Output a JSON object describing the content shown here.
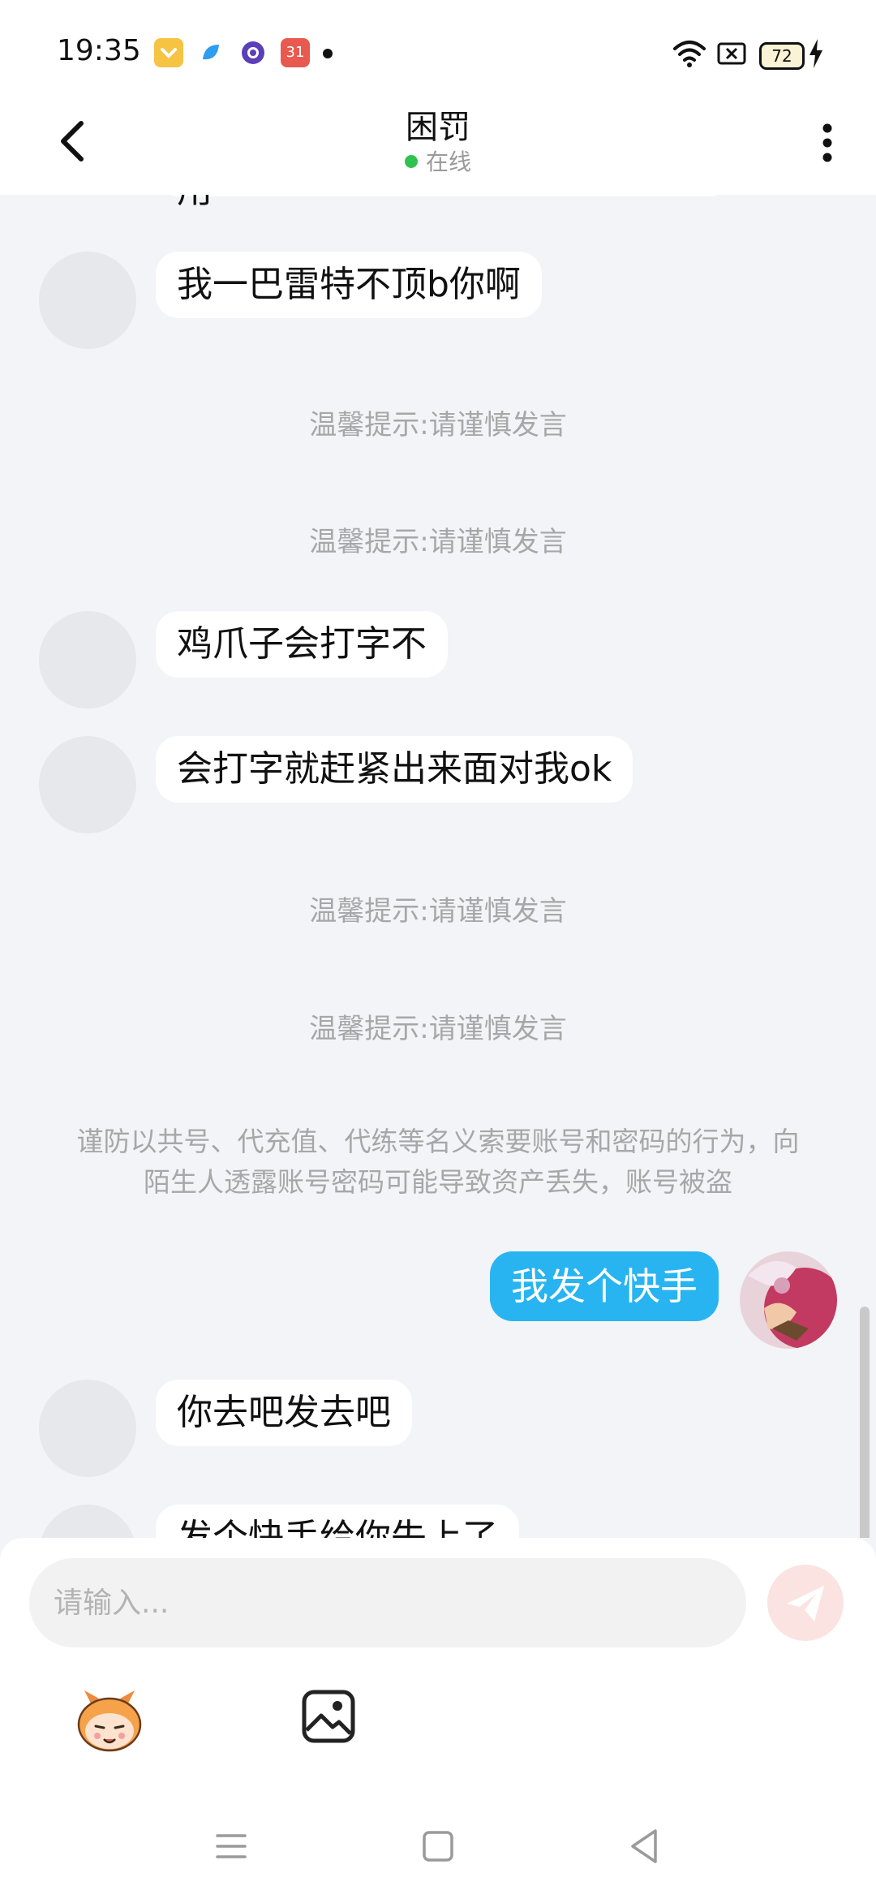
{
  "status_bar": {
    "time": "19:35",
    "app_icons": [
      {
        "name": "chevron-app-icon",
        "color": "#f6c343"
      },
      {
        "name": "blue-app-icon",
        "color": "#2f9cf0"
      },
      {
        "name": "purple-app-icon",
        "color": "#5b3fb8"
      },
      {
        "name": "calendar-app-icon",
        "color": "#e85a4f",
        "text": "31"
      }
    ],
    "battery": "72"
  },
  "header": {
    "title": "困罚",
    "status": "在线"
  },
  "chat": {
    "partial_top_text": "用",
    "messages": [
      {
        "type": "in",
        "text": "我一巴雷特不顶b你啊"
      },
      {
        "type": "notice",
        "text": "温馨提示:请谨慎发言"
      },
      {
        "type": "notice",
        "text": "温馨提示:请谨慎发言"
      },
      {
        "type": "in",
        "text": "鸡爪子会打字不"
      },
      {
        "type": "in",
        "text": "会打字就赶紧出来面对我ok"
      },
      {
        "type": "notice",
        "text": "温馨提示:请谨慎发言"
      },
      {
        "type": "notice",
        "text": "温馨提示:请谨慎发言"
      },
      {
        "type": "warning",
        "text": "谨防以共号、代充值、代练等名义索要账号和密码的行为，向陌生人透露账号密码可能导致资产丢失，账号被盗"
      },
      {
        "type": "out",
        "text": "我发个快手"
      },
      {
        "type": "in",
        "text": "你去吧发去吧"
      },
      {
        "type": "in",
        "text": "发个快手给你失上了"
      }
    ]
  },
  "input_panel": {
    "placeholder": "请输入..."
  },
  "colors": {
    "accent_blue": "#28b4f0",
    "online_green": "#2fc24f",
    "send_disabled": "#fbe3e2"
  }
}
